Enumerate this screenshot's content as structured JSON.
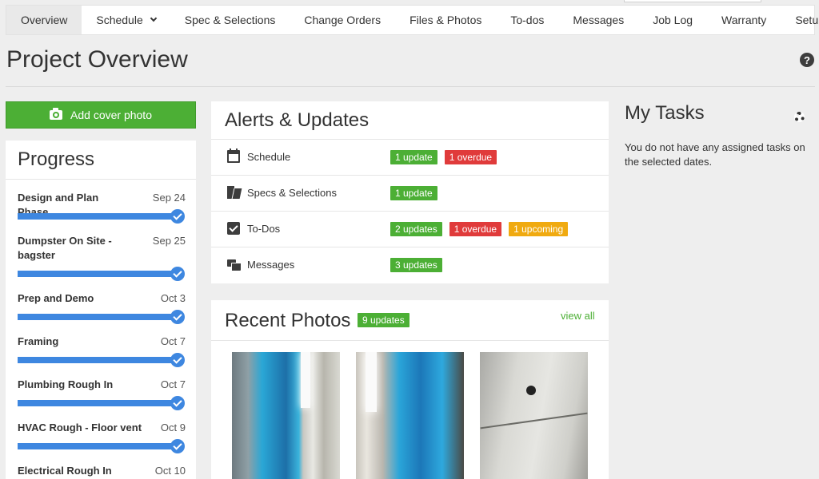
{
  "nav": {
    "tabs": [
      {
        "label": "Overview",
        "active": true
      },
      {
        "label": "Schedule",
        "dropdown": true
      },
      {
        "label": "Spec & Selections"
      },
      {
        "label": "Change Orders"
      },
      {
        "label": "Files & Photos"
      },
      {
        "label": "To-dos"
      },
      {
        "label": "Messages"
      },
      {
        "label": "Job Log"
      },
      {
        "label": "Warranty"
      },
      {
        "label": "Setup"
      }
    ]
  },
  "header": {
    "title": "Project Overview",
    "help_glyph": "?"
  },
  "cover_photo": {
    "label": "Add cover photo",
    "icon": "camera-icon"
  },
  "progress": {
    "title": "Progress",
    "phases": [
      {
        "name": "Design and Plan Phase",
        "date": "Sep 24",
        "complete": 1
      },
      {
        "name": "Dumpster On Site - bagster",
        "date": "Sep 25",
        "complete": 1
      },
      {
        "name": "Prep and Demo",
        "date": "Oct 3",
        "complete": 1
      },
      {
        "name": "Framing",
        "date": "Oct 7",
        "complete": 1
      },
      {
        "name": "Plumbing Rough In",
        "date": "Oct 7",
        "complete": 1
      },
      {
        "name": "HVAC Rough - Floor vent",
        "date": "Oct 9",
        "complete": 1
      },
      {
        "name": "Electrical Rough In",
        "date": "Oct 10",
        "complete": 1
      }
    ]
  },
  "alerts": {
    "title": "Alerts & Updates",
    "rows": [
      {
        "label": "Schedule",
        "icon": "calendar-icon",
        "badges": [
          {
            "text": "1 update",
            "color": "green"
          },
          {
            "text": "1 overdue",
            "color": "red"
          }
        ]
      },
      {
        "label": "Specs & Selections",
        "icon": "swatch-icon",
        "badges": [
          {
            "text": "1 update",
            "color": "green"
          }
        ]
      },
      {
        "label": "To-Dos",
        "icon": "checkbox-icon",
        "badges": [
          {
            "text": "2 updates",
            "color": "green"
          },
          {
            "text": "1 overdue",
            "color": "red"
          },
          {
            "text": "1 upcoming",
            "color": "amber"
          }
        ]
      },
      {
        "label": "Messages",
        "icon": "chat-icon",
        "badges": [
          {
            "text": "3 updates",
            "color": "green"
          }
        ]
      }
    ]
  },
  "photos": {
    "title": "Recent Photos",
    "badge": "9 updates",
    "view_all": "view all"
  },
  "tasks": {
    "title": "My Tasks",
    "empty_text": "You do not have any assigned tasks on the selected dates."
  },
  "colors": {
    "accent_green": "#4caf35",
    "progress_blue": "#3e87e0",
    "badge_red": "#e03b3b",
    "badge_amber": "#f0aa10",
    "background": "#eeeeee"
  }
}
